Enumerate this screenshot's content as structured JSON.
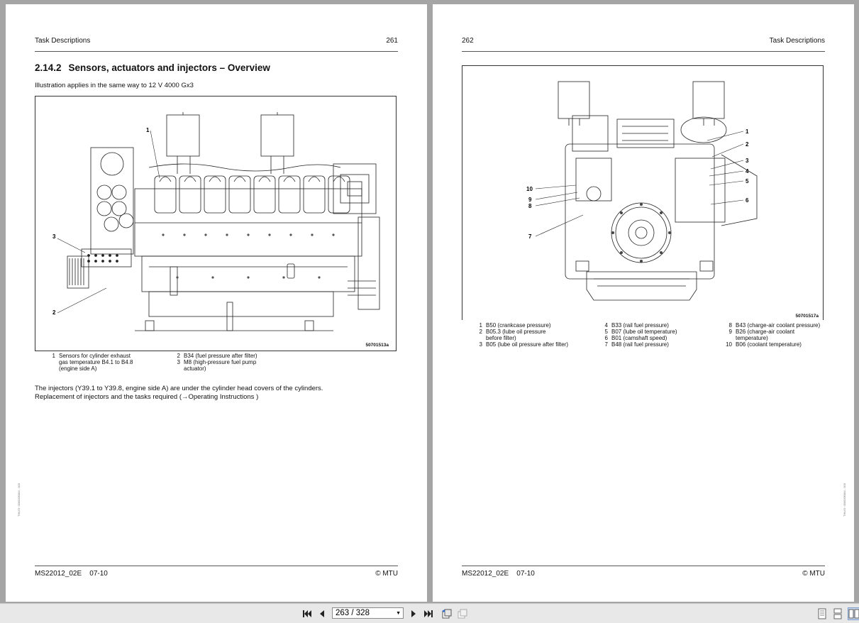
{
  "left_page": {
    "header_left": "Task Descriptions",
    "header_right": "261",
    "section_number": "2.14.2",
    "section_title": "Sensors, actuators and injectors – Overview",
    "intro": "Illustration applies in the same way to 12 V 4000 Gx3",
    "figure_id": "50701513a",
    "callouts": [
      "1",
      "2",
      "3"
    ],
    "legend_col1": [
      {
        "num": "1",
        "text": "Sensors for cylinder exhaust\ngas temperature B4.1 to B4.8\n(engine side A)"
      }
    ],
    "legend_col2": [
      {
        "num": "2",
        "text": "B34 (fuel pressure after filter)"
      },
      {
        "num": "3",
        "text": "M8 (high-pressure fuel pump\nactuator)"
      }
    ],
    "body_line1": "The injectors (Y39.1 to Y39.8, engine side A) are under the cylinder head covers of the cylinders.",
    "body_line2": "Replacement of injectors and the tasks required (→Operating Instructions )",
    "side_code": "TIM-ID: 0000006484 - 003",
    "footer_left": "MS22012_02E    07-10",
    "footer_right": "© MTU"
  },
  "right_page": {
    "header_left": "262",
    "header_right": "Task Descriptions",
    "figure_id": "50701517a",
    "callouts": [
      "1",
      "2",
      "3",
      "4",
      "5",
      "6",
      "7",
      "8",
      "9",
      "10"
    ],
    "legend_col1": [
      {
        "num": "1",
        "text": "B50 (crankcase pressure)"
      },
      {
        "num": "2",
        "text": "B05.3 (lube oil pressure\nbefore filter)"
      },
      {
        "num": "3",
        "text": "B05 (lube oil pressure after filter)"
      }
    ],
    "legend_col2": [
      {
        "num": "4",
        "text": "B33 (rail fuel pressure)"
      },
      {
        "num": "5",
        "text": "B07 (lube oil temperature)"
      },
      {
        "num": "6",
        "text": "B01 (camshaft speed)"
      },
      {
        "num": "7",
        "text": "B48 (rail fuel pressure)"
      }
    ],
    "legend_col3": [
      {
        "num": "8",
        "text": "B43 (charge-air coolant pressure)"
      },
      {
        "num": "9",
        "text": "B26 (charge-air coolant\ntemperature)"
      },
      {
        "num": "10",
        "text": "B06 (coolant temperature)"
      }
    ],
    "side_code": "TIM-ID: 0000006484 - 003",
    "footer_left": "MS22012_02E    07-10",
    "footer_right": "© MTU"
  },
  "toolbar": {
    "page_indicator": "263 / 328",
    "icons": [
      "first-page-icon",
      "previous-page-icon",
      "next-page-icon",
      "last-page-icon",
      "go-back-icon",
      "go-forward-icon",
      "single-page-view-icon",
      "continuous-view-icon",
      "two-page-view-icon"
    ]
  }
}
